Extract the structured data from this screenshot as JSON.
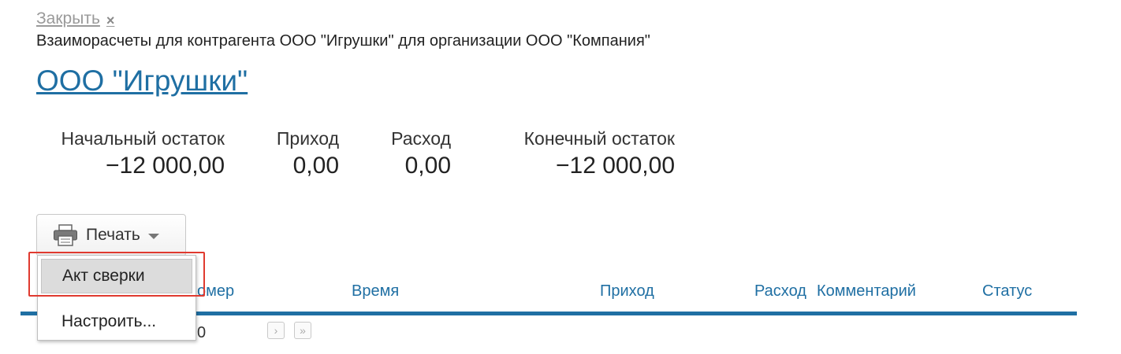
{
  "header": {
    "close_label": "Закрыть",
    "close_icon": "×",
    "subtitle": "Взаиморасчеты для контрагента ООО \"Игрушки\" для организации ООО \"Компания\"",
    "counterparty": "ООО \"Игрушки\""
  },
  "balances": {
    "opening": {
      "label": "Начальный остаток",
      "value": "−12 000,00"
    },
    "income": {
      "label": "Приход",
      "value": "0,00"
    },
    "expense": {
      "label": "Расход",
      "value": "0,00"
    },
    "closing": {
      "label": "Конечный остаток",
      "value": "−12 000,00"
    }
  },
  "toolbar": {
    "print_label": "Печать",
    "print_icon": "printer-icon"
  },
  "dropdown": {
    "items": [
      {
        "label": "Акт сверки",
        "active": true
      },
      {
        "label": "Настроить..."
      }
    ]
  },
  "table": {
    "columns": [
      "Номер",
      "Время",
      "Приход",
      "Расход",
      "Комментарий",
      "Статус"
    ],
    "visible_number_fragment": "омер",
    "row_fragment": "0"
  },
  "pager": {
    "next": "›",
    "last": "»"
  },
  "colors": {
    "accent": "#1f6fa3",
    "highlight": "#e03a2f"
  }
}
